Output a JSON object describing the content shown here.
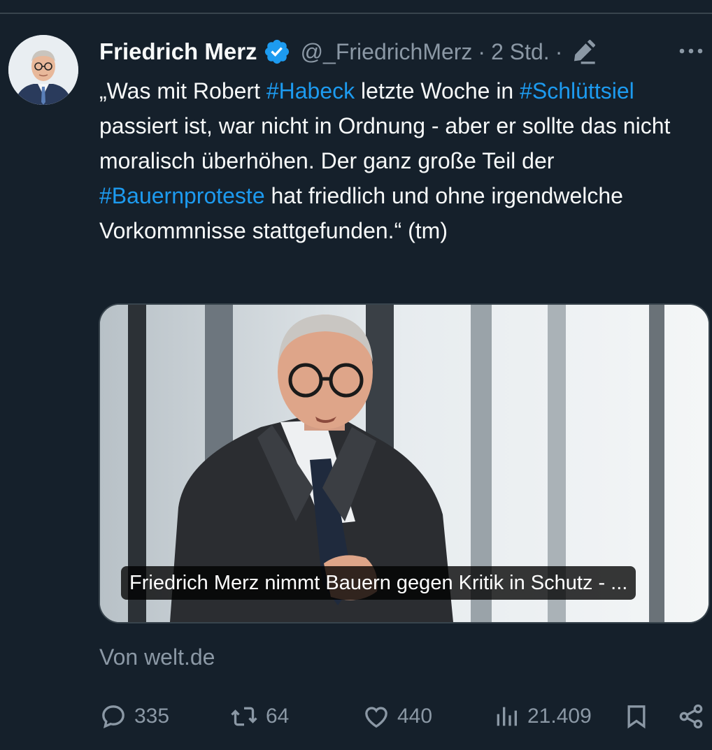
{
  "tweet": {
    "author_name": "Friedrich Merz",
    "handle": "@_FriedrichMerz",
    "separator": "·",
    "time": "2 Std.",
    "text_parts": [
      {
        "text": "„Was mit Robert ",
        "tag": false
      },
      {
        "text": "#Habeck",
        "tag": true
      },
      {
        "text": " letzte Woche in ",
        "tag": false
      },
      {
        "text": "#Schlüttsiel",
        "tag": true
      },
      {
        "text": " passiert ist, war nicht in Ordnung - aber er sollte das nicht moralisch überhöhen. Der ganz große Teil der ",
        "tag": false
      },
      {
        "text": "#Bauernproteste",
        "tag": true
      },
      {
        "text": " hat friedlich und ohne  irgendwelche Vorkommnisse stattgefunden.“ (tm)",
        "tag": false
      }
    ]
  },
  "card": {
    "caption": "Friedrich Merz nimmt Bauern gegen Kritik in Schutz - ...",
    "source": "Von welt.de"
  },
  "actions": {
    "replies": "335",
    "retweets": "64",
    "likes": "440",
    "views": "21.409"
  },
  "colors": {
    "background": "#15202b",
    "text": "#f7f9f9",
    "secondary": "#8b98a5",
    "accent": "#1d9bf0",
    "divider": "#38444d"
  },
  "icons": [
    "verified-badge-icon",
    "edit-pencil-icon",
    "more-options-icon",
    "reply-icon",
    "retweet-icon",
    "like-icon",
    "views-icon",
    "bookmark-icon",
    "share-icon"
  ]
}
